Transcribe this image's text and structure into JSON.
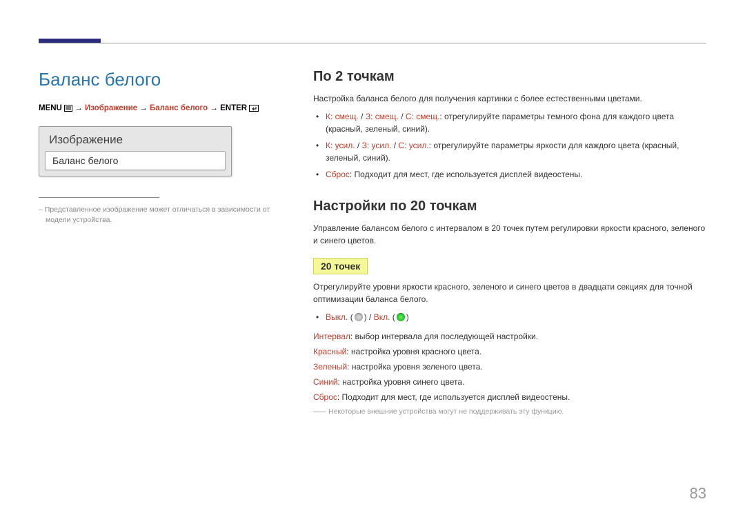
{
  "left": {
    "title": "Баланс белого",
    "breadcrumb": {
      "menu": "MENU",
      "arrow": "→",
      "image": "Изображение",
      "white_balance": "Баланс белого",
      "enter": "ENTER"
    },
    "menu_box": {
      "title": "Изображение",
      "item": "Баланс белого"
    },
    "note": "Представленное изображение может отличаться в зависимости от модели устройства."
  },
  "right": {
    "h1": "По 2 точкам",
    "h1_desc": "Настройка баланса белого для получения картинки с более естественными цветами.",
    "b1_red": "К: смещ.",
    "b1_sep": " / ",
    "b1_green": "З: смещ.",
    "b1_blue": "С: смещ.",
    "b1_text": ": отрегулируйте параметры темного фона для каждого цвета (красный, зеленый, синий).",
    "b2_red": "К: усил.",
    "b2_green": "З: усил.",
    "b2_blue": "С: усил.",
    "b2_text": ": отрегулируйте параметры яркости для каждого цвета (красный, зеленый, синий).",
    "b3_red": "Сброс",
    "b3_text": ": Подходит для мест, где используется дисплей видеостены.",
    "h2": "Настройки по 20 точкам",
    "h2_desc": "Управление балансом белого с интервалом в 20 точек путем регулировки яркости красного, зеленого и синего цветов.",
    "hl": "20 точек",
    "hl_desc": "Отрегулируйте уровни яркости красного, зеленого и синего цветов в двадцати секциях для точной оптимизации баланса белого.",
    "toggle_off": "Выкл.",
    "toggle_on": "Вкл.",
    "p_interval_label": "Интервал",
    "p_interval_text": ": выбор интервала для последующей настройки.",
    "p_red_label": "Красный",
    "p_red_text": ": настройка уровня красного цвета.",
    "p_green_label": "Зеленый",
    "p_green_text": ": настройка уровня зеленого цвета.",
    "p_blue_label": "Синий",
    "p_blue_text": ": настройка уровня синего цвета.",
    "p_reset_label": "Сброс",
    "p_reset_text": ": Подходит для мест, где используется дисплей видеостены.",
    "footnote": "Некоторые внешние устройства могут не поддерживать эту функцию."
  },
  "page_number": "83"
}
